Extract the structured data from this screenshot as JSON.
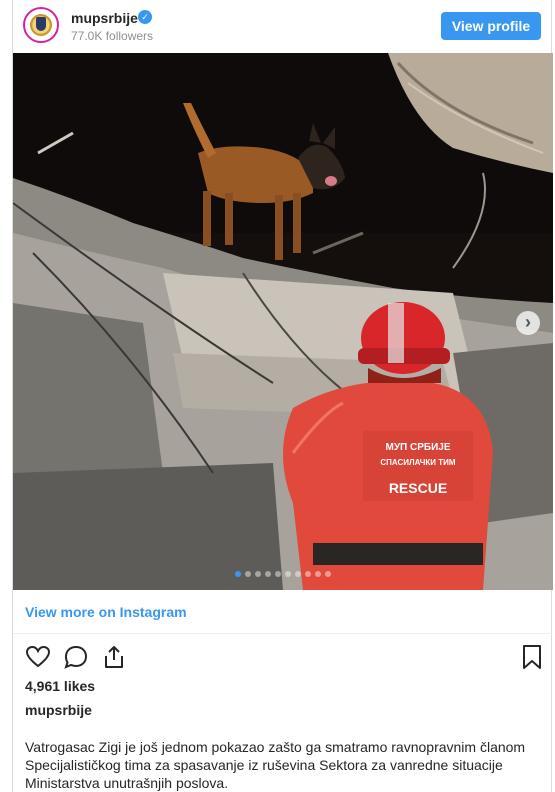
{
  "header": {
    "username": "mupsrbije",
    "verified_mark": "✓",
    "followers": "77.0K followers",
    "view_profile_label": "View profile"
  },
  "media": {
    "helmet_text": "",
    "jacket_text_line1": "МУП СРБИЈЕ",
    "jacket_text_line2": "СПАСИЛАЧКИ ТИМ",
    "jacket_text_line3": "RESCUE",
    "carousel_dots": 10,
    "active_dot": 0,
    "next_arrow": "›"
  },
  "view_more_label": "View more on Instagram",
  "icons": [
    "heart-icon",
    "comment-icon",
    "share-icon",
    "bookmark-icon"
  ],
  "likes": "4,961 likes",
  "caption_username": "mupsrbije",
  "caption_text": "Vatrogasac Zigi je još jednom pokazao zašto ga smatramo ravnopravnim članom Specijalističkog tima za spasavanje iz ruševina Sektora za vanredne situacije Ministarstva unutrašnjih poslova.",
  "colors": {
    "accent": "#3897f0",
    "jacket": "#e0493b",
    "helmet": "#d8262a"
  }
}
